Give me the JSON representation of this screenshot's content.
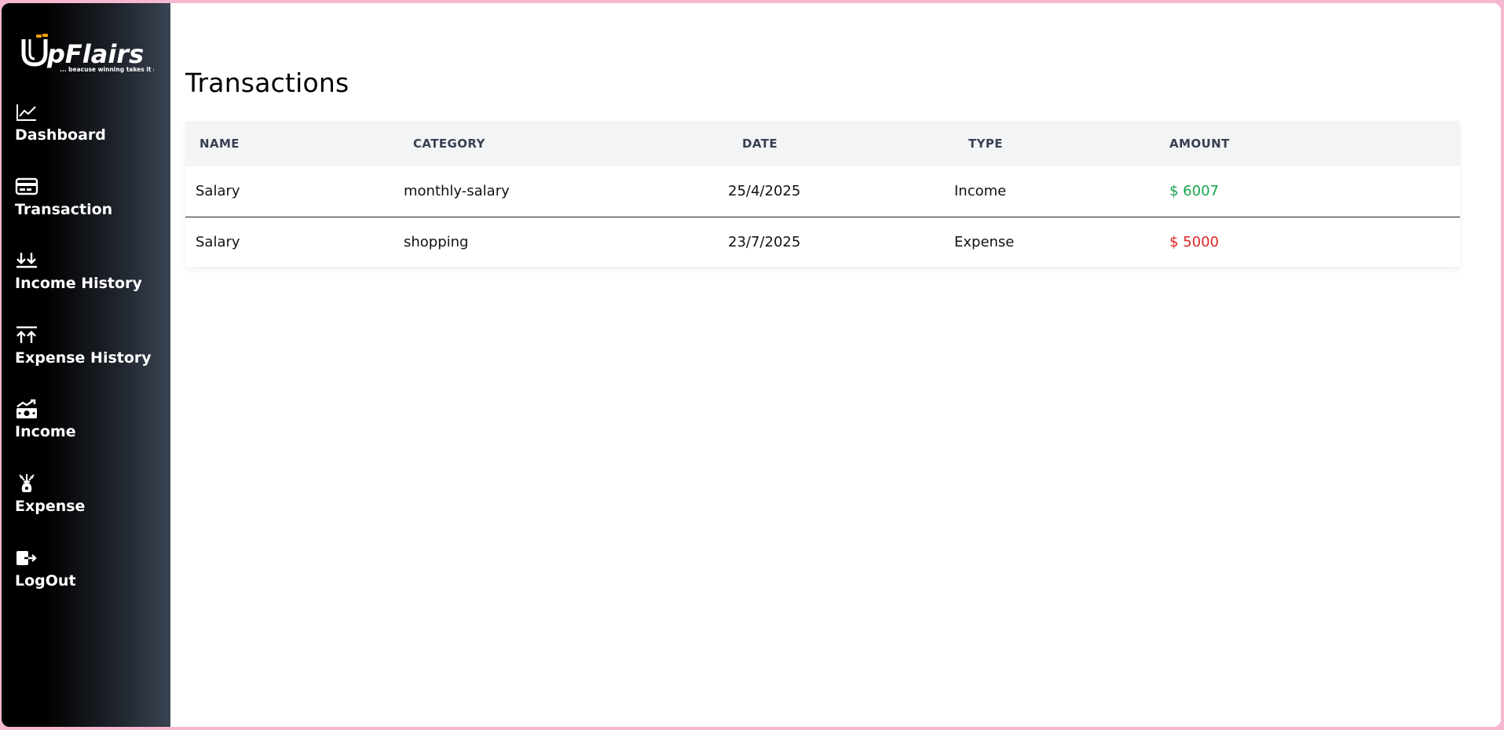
{
  "brand": {
    "name": "pFlairs",
    "tagline": "... beacuse winning takes it all"
  },
  "sidebar": {
    "items": [
      {
        "label": "Dashboard",
        "icon": "chart-line-icon"
      },
      {
        "label": "Transaction",
        "icon": "credit-card-icon"
      },
      {
        "label": "Income History",
        "icon": "arrows-down-icon"
      },
      {
        "label": "Expense History",
        "icon": "arrows-up-icon"
      },
      {
        "label": "Income",
        "icon": "money-growth-icon"
      },
      {
        "label": "Expense",
        "icon": "money-bag-icon"
      },
      {
        "label": "LogOut",
        "icon": "logout-icon"
      }
    ]
  },
  "page": {
    "title": "Transactions"
  },
  "table": {
    "headers": [
      "NAME",
      "CATEGORY",
      "DATE",
      "TYPE",
      "AMOUNT"
    ],
    "rows": [
      {
        "name": "Salary",
        "category": "monthly-salary",
        "date": "25/4/2025",
        "type": "Income",
        "amount": "$ 6007",
        "amount_color": "#16a34a"
      },
      {
        "name": "Salary",
        "category": "shopping",
        "date": "23/7/2025",
        "type": "Expense",
        "amount": "$ 5000",
        "amount_color": "#dc2626"
      }
    ]
  },
  "colors": {
    "income": "#16a34a",
    "expense": "#dc2626",
    "page_border": "#f6b8d0"
  }
}
